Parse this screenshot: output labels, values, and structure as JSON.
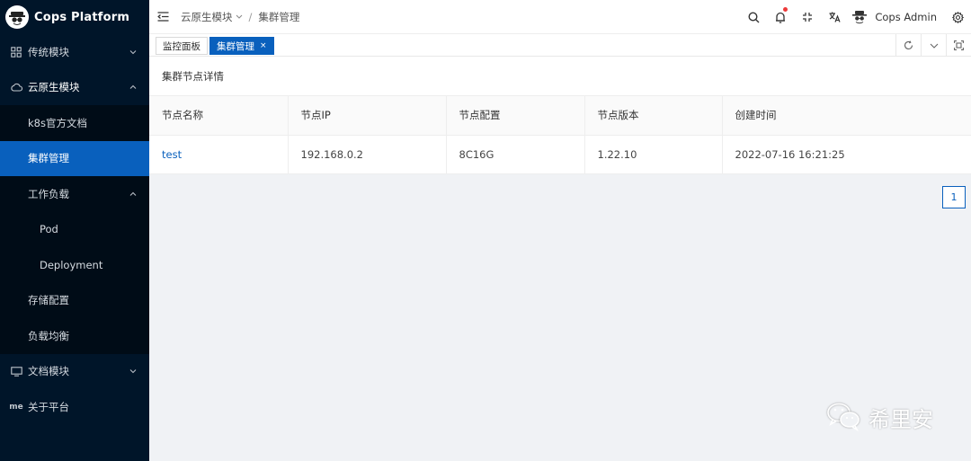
{
  "app": {
    "title": "Cops Platform"
  },
  "sidebar": {
    "items": [
      {
        "label": "传统模块",
        "icon": "grid-icon"
      },
      {
        "label": "云原生模块",
        "icon": "cloud-icon"
      },
      {
        "label": "k8s官方文档"
      },
      {
        "label": "集群管理"
      },
      {
        "label": "工作负载"
      },
      {
        "label": "Pod"
      },
      {
        "label": "Deployment"
      },
      {
        "label": "存储配置"
      },
      {
        "label": "负载均衡"
      },
      {
        "label": "文档模块",
        "icon": "monitor-icon"
      },
      {
        "label": "关于平台",
        "icon_text": "me"
      }
    ]
  },
  "header": {
    "breadcrumb": [
      "云原生模块",
      "集群管理"
    ],
    "user_name": "Cops Admin"
  },
  "tabs": [
    {
      "label": "监控面板"
    },
    {
      "label": "集群管理",
      "close": "×"
    }
  ],
  "main": {
    "panel_title": "集群节点详情",
    "columns": [
      "节点名称",
      "节点IP",
      "节点配置",
      "节点版本",
      "创建时间"
    ],
    "rows": [
      [
        "test",
        "192.168.0.2",
        "8C16G",
        "1.22.10",
        "2022-07-16 16:21:25"
      ]
    ],
    "current_page": "1"
  },
  "watermark": {
    "text": "希里安"
  },
  "colors": {
    "sidebar_bg": "#001529",
    "accent": "#0960bd",
    "notify_dot": "#ed3a3a"
  }
}
